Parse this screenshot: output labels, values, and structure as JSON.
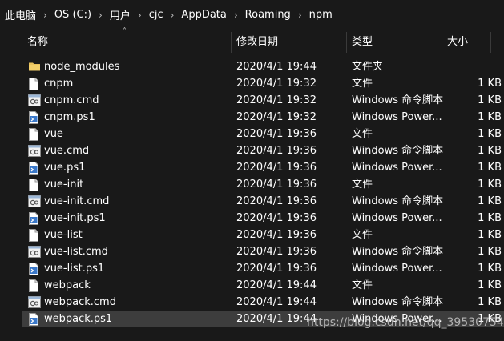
{
  "address_bar": {
    "crumbs": [
      "此电脑",
      "OS (C:)",
      "用户",
      "cjc",
      "AppData",
      "Roaming",
      "npm"
    ],
    "separator_icon": "chevron-right-icon"
  },
  "columns": {
    "name": "名称",
    "date": "修改日期",
    "type": "类型",
    "size": "大小",
    "sort_icon": "sort-ascending-icon"
  },
  "files": [
    {
      "name": "node_modules",
      "date": "2020/4/1 19:44",
      "type": "文件夹",
      "size": "",
      "icon": "folder-icon"
    },
    {
      "name": "cnpm",
      "date": "2020/4/1 19:32",
      "type": "文件",
      "size": "1 KB",
      "icon": "file-icon"
    },
    {
      "name": "cnpm.cmd",
      "date": "2020/4/1 19:32",
      "type": "Windows 命令脚本",
      "size": "1 KB",
      "icon": "cmd-script-icon"
    },
    {
      "name": "cnpm.ps1",
      "date": "2020/4/1 19:32",
      "type": "Windows Power...",
      "size": "1 KB",
      "icon": "powershell-script-icon"
    },
    {
      "name": "vue",
      "date": "2020/4/1 19:36",
      "type": "文件",
      "size": "1 KB",
      "icon": "file-icon"
    },
    {
      "name": "vue.cmd",
      "date": "2020/4/1 19:36",
      "type": "Windows 命令脚本",
      "size": "1 KB",
      "icon": "cmd-script-icon"
    },
    {
      "name": "vue.ps1",
      "date": "2020/4/1 19:36",
      "type": "Windows Power...",
      "size": "1 KB",
      "icon": "powershell-script-icon"
    },
    {
      "name": "vue-init",
      "date": "2020/4/1 19:36",
      "type": "文件",
      "size": "1 KB",
      "icon": "file-icon"
    },
    {
      "name": "vue-init.cmd",
      "date": "2020/4/1 19:36",
      "type": "Windows 命令脚本",
      "size": "1 KB",
      "icon": "cmd-script-icon"
    },
    {
      "name": "vue-init.ps1",
      "date": "2020/4/1 19:36",
      "type": "Windows Power...",
      "size": "1 KB",
      "icon": "powershell-script-icon"
    },
    {
      "name": "vue-list",
      "date": "2020/4/1 19:36",
      "type": "文件",
      "size": "1 KB",
      "icon": "file-icon"
    },
    {
      "name": "vue-list.cmd",
      "date": "2020/4/1 19:36",
      "type": "Windows 命令脚本",
      "size": "1 KB",
      "icon": "cmd-script-icon"
    },
    {
      "name": "vue-list.ps1",
      "date": "2020/4/1 19:36",
      "type": "Windows Power...",
      "size": "1 KB",
      "icon": "powershell-script-icon"
    },
    {
      "name": "webpack",
      "date": "2020/4/1 19:44",
      "type": "文件",
      "size": "1 KB",
      "icon": "file-icon"
    },
    {
      "name": "webpack.cmd",
      "date": "2020/4/1 19:44",
      "type": "Windows 命令脚本",
      "size": "1 KB",
      "icon": "cmd-script-icon"
    },
    {
      "name": "webpack.ps1",
      "date": "2020/4/1 19:44",
      "type": "Windows Power...",
      "size": "1 KB",
      "icon": "powershell-script-icon",
      "selected": true
    }
  ],
  "watermark": "https://blog.csdn.net/qq_39530754",
  "colors": {
    "background": "#191919",
    "selected_row": "#3d3d3d",
    "folder": "#e8c15c",
    "ps_blue": "#3a78c9"
  }
}
